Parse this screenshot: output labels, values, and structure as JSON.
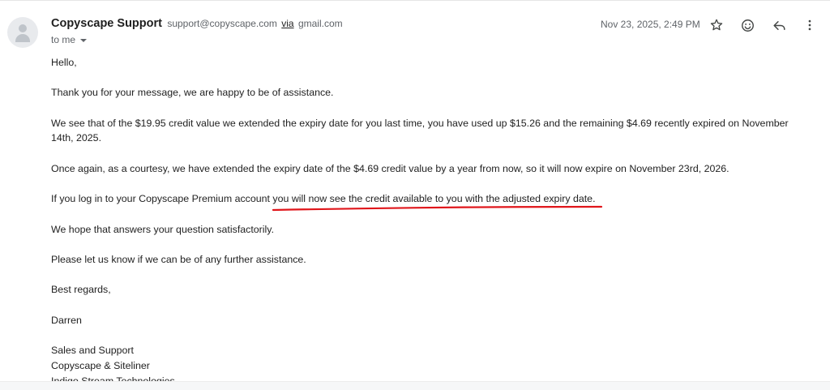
{
  "header": {
    "sender_name": "Copyscape Support",
    "sender_email": "support@copyscape.com",
    "via_label": "via",
    "via_domain": "gmail.com",
    "recipient": "to me",
    "date": "Nov 23, 2025, 2:49 PM",
    "icons": [
      "star-icon",
      "emoji-react-icon",
      "reply-icon",
      "more-options-icon"
    ]
  },
  "body": {
    "greeting": "Hello,",
    "p1": "Thank you for your message, we are happy to be of assistance.",
    "p2": "We see that of the $19.95 credit value we extended the expiry date for you last time, you have used up $15.26 and the remaining $4.69 recently expired on November 14th, 2025.",
    "p3": "Once again, as a courtesy, we have extended the expiry date of the $4.69 credit value by a year from now, so it will now expire on November 23rd, 2026.",
    "p4": "If you log in to your Copyscape Premium account you will now see the credit available to you with the adjusted expiry date.",
    "p5": "We hope that answers your question satisfactorily.",
    "p6": "Please let us know if we can be of any further assistance.",
    "closing": "Best regards,",
    "signature_name": "Darren",
    "signature_line1": "Sales and Support",
    "signature_line2": "Copyscape & Siteliner",
    "signature_line3": "Indigo Stream Technologies"
  },
  "colors": {
    "annotation_underline": "#e0161b",
    "secondary_text": "#5f6368",
    "body_text": "#222222"
  }
}
